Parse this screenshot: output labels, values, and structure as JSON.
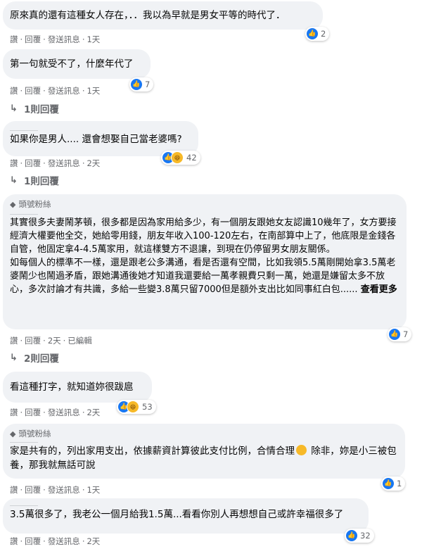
{
  "actions": {
    "like": "讚",
    "reply": "回覆",
    "send": "發送訊息",
    "edited": "已編輯"
  },
  "comments": [
    {
      "text": "原來真的還有這種女人存在，．．我以為早就是男女平等的時代了．",
      "time": "1天",
      "reactions": "2"
    },
    {
      "text": "第一句就受不了，什麼年代了",
      "time": "1天",
      "reactions": "7",
      "replies": "1則回覆"
    },
    {
      "text": "如果你是男人.... 還會想娶自己當老婆嗎?",
      "time": "2天",
      "reactions": "42",
      "replies": "1則回覆"
    },
    {
      "badge": "頭號粉絲",
      "text": "其實很多夫妻鬧茅頓，很多都是因為家用給多少，有一個朋友跟她女友認識10幾年了，女方要接經濟大權要他全交，她給零用錢，朋友年收入100-120左右，在南部算中上了，他底限是金錢各自管，他固定拿4-4.5萬家用，就這樣雙方不退讓，到現在仍停留男女朋友關係。\n如每個人的標準不一樣，還是跟老公多溝通，看是否還有空間，比如我領5.5萬剛開始拿3.5萬老婆鬧少也鬧過矛盾，跟她溝通後她才知道我還要給一萬孝親費只剩一萬，她還是嫌留太多不放心，多次討論才有共識，多給一些變3.8萬只留7000但是額外支出比如同事紅白包......",
      "see_more": "查看更多",
      "time": "2天",
      "reactions": "7",
      "replies": "2則回覆"
    },
    {
      "text": "看這種打字，就知道妳很跋扈",
      "time": "2天",
      "reactions": "53"
    },
    {
      "badge": "頭號粉絲",
      "text_a": "家是共有的，列出家用支出，依據薪資計算彼此支付比例，合情合理",
      "text_b": " 除非，妳是小三被包養，那我就無話可說",
      "time": "1天",
      "reactions": "1"
    },
    {
      "text": "3.5萬很多了，我老公一個月給我1.5萬...看看你別人再想想自己或許幸福很多了",
      "time": "2天",
      "reactions": "32"
    }
  ]
}
